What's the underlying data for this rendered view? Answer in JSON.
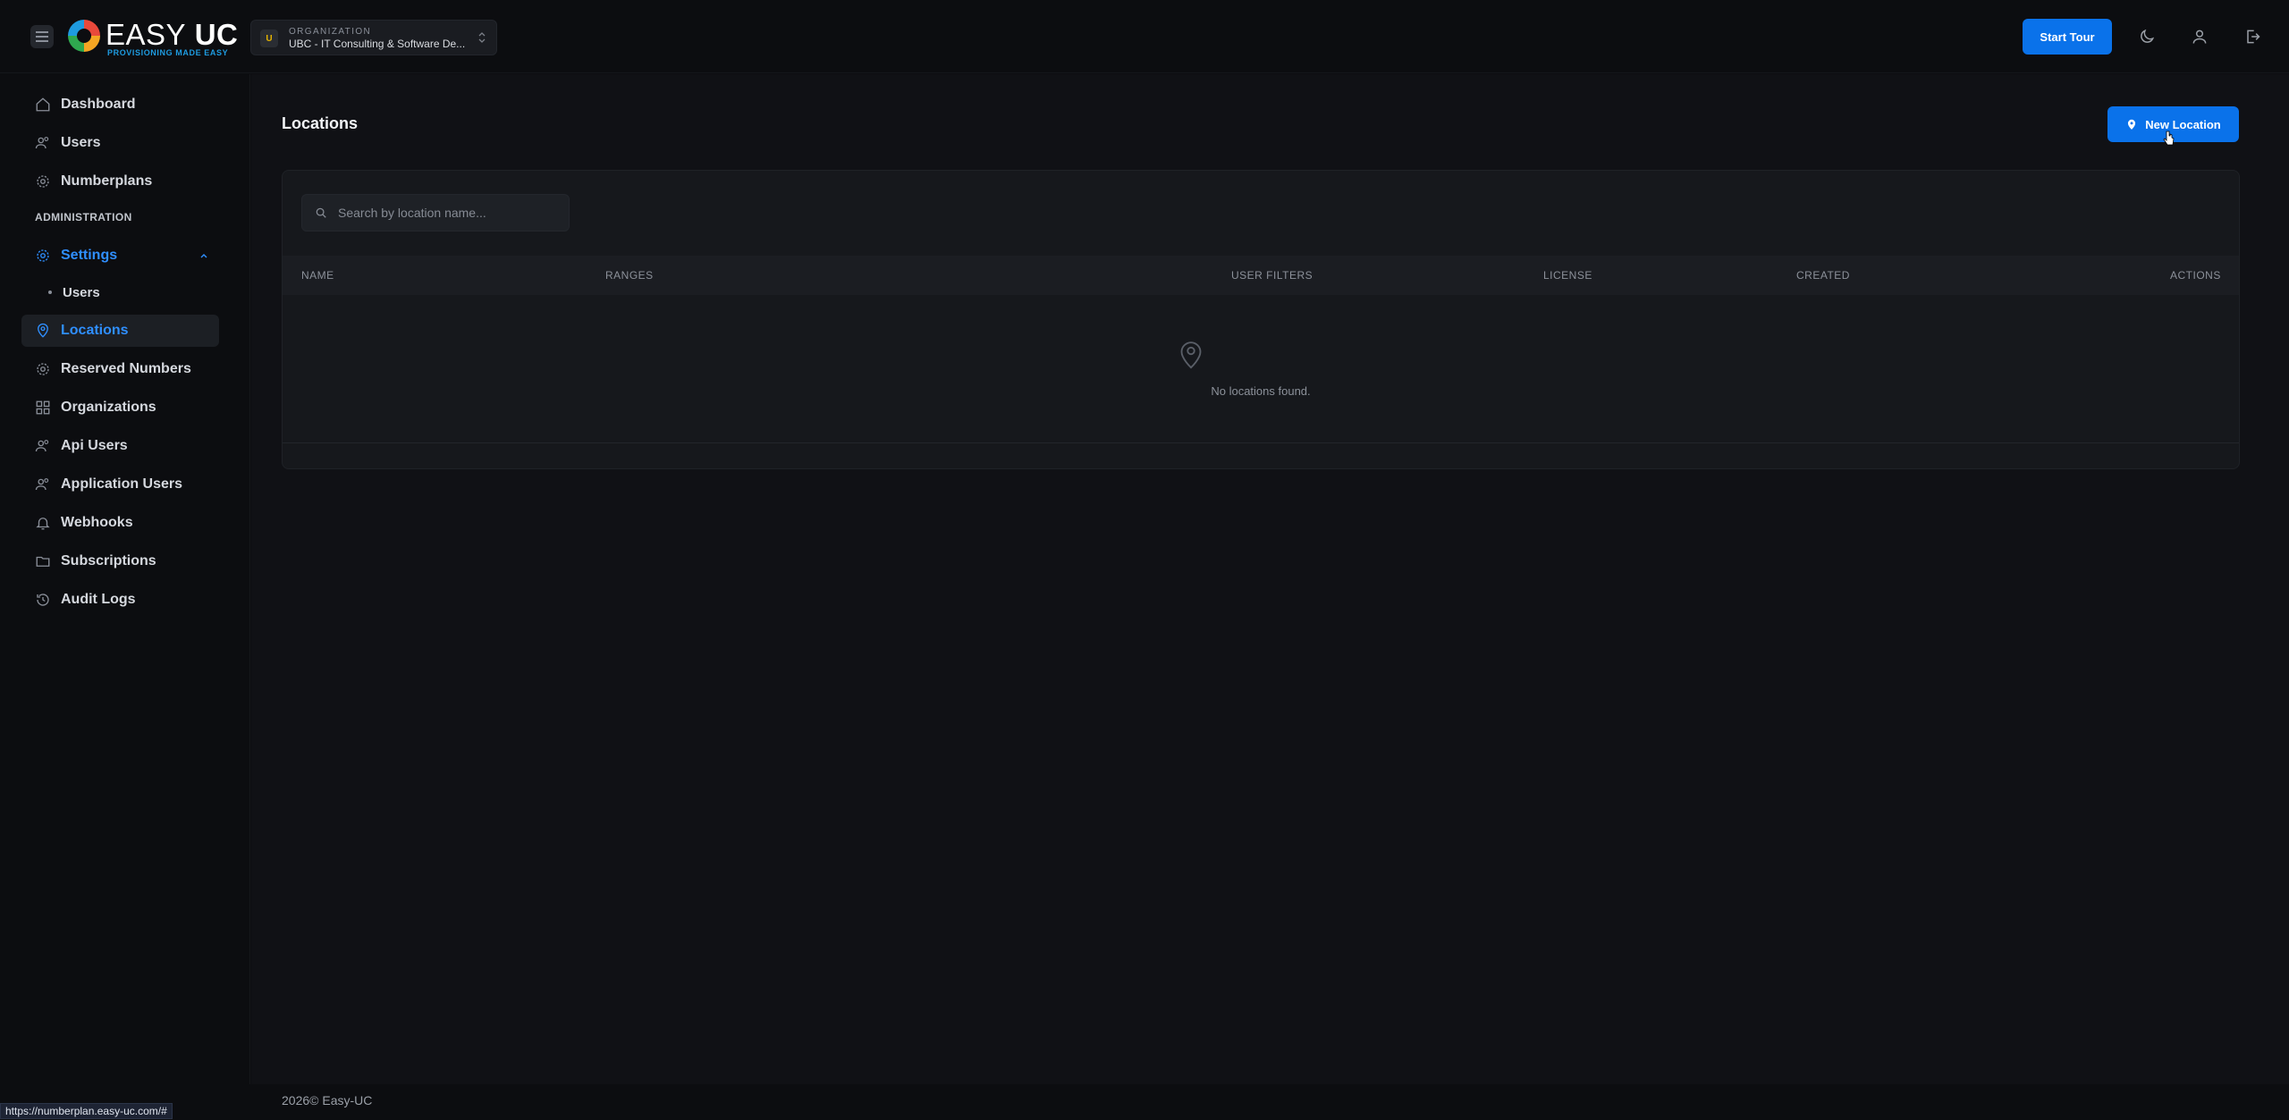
{
  "header": {
    "logo": {
      "easy": "EASY",
      "uc": " UC",
      "tagline": "PROVISIONING MADE EASY"
    },
    "organization": {
      "label": "ORGANIZATION",
      "avatar": "U",
      "name": "UBC - IT Consulting & Software De..."
    },
    "start_tour": "Start Tour"
  },
  "sidebar": {
    "items": [
      {
        "label": "Dashboard",
        "icon": "home-icon"
      },
      {
        "label": "Users",
        "icon": "users-icon"
      },
      {
        "label": "Numberplans",
        "icon": "cog-icon"
      }
    ],
    "section": "ADMINISTRATION",
    "settings": {
      "label": "Settings",
      "sub": "Users"
    },
    "admin_items": [
      {
        "label": "Locations",
        "icon": "map-pin-icon",
        "active": true
      },
      {
        "label": "Reserved Numbers",
        "icon": "cog-icon"
      },
      {
        "label": "Organizations",
        "icon": "grid-icon"
      },
      {
        "label": "Api Users",
        "icon": "users-icon"
      },
      {
        "label": "Application Users",
        "icon": "users-icon"
      },
      {
        "label": "Webhooks",
        "icon": "bell-icon"
      },
      {
        "label": "Subscriptions",
        "icon": "folder-icon"
      },
      {
        "label": "Audit Logs",
        "icon": "history-icon"
      }
    ]
  },
  "main": {
    "title": "Locations",
    "new_location": "New Location",
    "search": {
      "placeholder": "Search by location name...",
      "value": ""
    },
    "columns": [
      "NAME",
      "RANGES",
      "USER FILTERS",
      "LICENSE",
      "CREATED",
      "ACTIONS"
    ],
    "empty": "No locations found."
  },
  "footer": "2026© Easy-UC",
  "status_url": "https://numberplan.easy-uc.com/#",
  "colors": {
    "accent": "#0a72ea",
    "active_text": "#2f8fff",
    "background": "#0c0d10"
  }
}
